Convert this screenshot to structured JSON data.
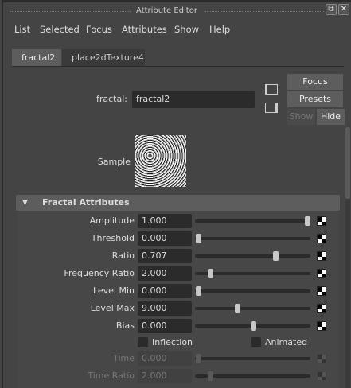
{
  "window": {
    "title": "Attribute Editor"
  },
  "menu": [
    "List",
    "Selected",
    "Focus",
    "Attributes",
    "Show",
    "Help"
  ],
  "tabs": [
    {
      "label": "fractal2",
      "active": true
    },
    {
      "label": "place2dTexture4",
      "active": false
    }
  ],
  "node": {
    "label": "fractal:",
    "value": "fractal2"
  },
  "buttons": {
    "focus": "Focus",
    "presets": "Presets",
    "show": "Show",
    "hide": "Hide"
  },
  "sample_label": "Sample",
  "section": {
    "title": "Fractal Attributes",
    "expanded": true
  },
  "attributes": [
    {
      "label": "Amplitude",
      "value": "1.000",
      "slider": 1.0,
      "enabled": true
    },
    {
      "label": "Threshold",
      "value": "0.000",
      "slider": 0.0,
      "enabled": true
    },
    {
      "label": "Ratio",
      "value": "0.707",
      "slider": 0.707,
      "enabled": true
    },
    {
      "label": "Frequency Ratio",
      "value": "2.000",
      "slider": 0.11,
      "enabled": true
    },
    {
      "label": "Level Min",
      "value": "0.000",
      "slider": 0.0,
      "enabled": true
    },
    {
      "label": "Level Max",
      "value": "9.000",
      "slider": 0.36,
      "enabled": true
    },
    {
      "label": "Bias",
      "value": "0.000",
      "slider": 0.5,
      "enabled": true
    }
  ],
  "checkboxes": [
    {
      "label": "Inflection",
      "checked": false
    },
    {
      "label": "Animated",
      "checked": false
    }
  ],
  "disabled_attributes": [
    {
      "label": "Time",
      "value": "0.000",
      "slider": 0.0,
      "enabled": false
    },
    {
      "label": "Time Ratio",
      "value": "2.000",
      "slider": 0.11,
      "enabled": false
    }
  ]
}
